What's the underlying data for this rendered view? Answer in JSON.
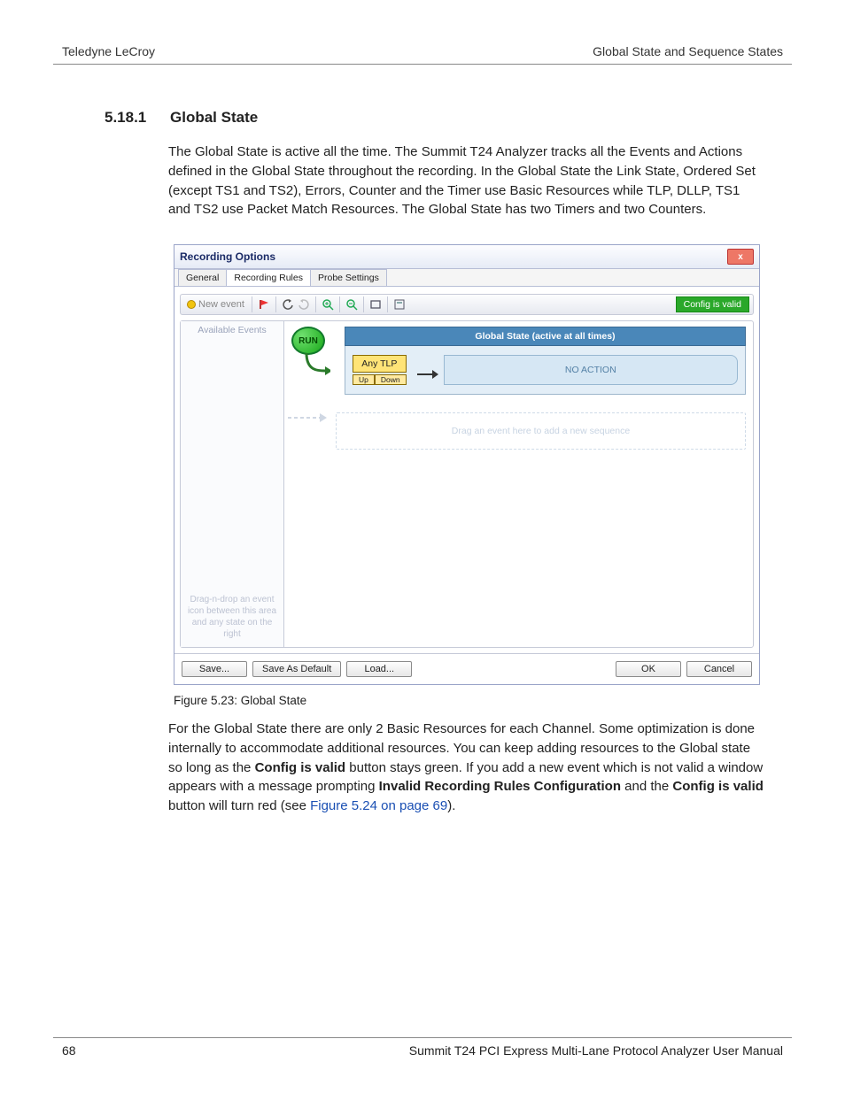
{
  "header": {
    "left": "Teledyne LeCroy",
    "right": "Global State and Sequence States"
  },
  "section": {
    "number": "5.18.1",
    "title": "Global State"
  },
  "paragraphs": {
    "p1": "The Global State is active all the time. The Summit T24 Analyzer tracks all the Events and Actions defined in the Global State throughout the recording. In the Global State the Link State, Ordered Set (except TS1 and TS2), Errors, Counter and the Timer use Basic Resources while TLP, DLLP, TS1 and TS2 use Packet Match Resources.  The Global State has two Timers and two Counters.",
    "p2_pre": "For the Global State there are only 2 Basic Resources for each Channel. Some optimization is done internally to accommodate additional resources. You can keep adding resources to the Global state so long as the ",
    "p2_bold1": "Config is valid",
    "p2_mid1": " button stays green. If you add a new event which is not valid a window appears with a message prompting ",
    "p2_bold2": "Invalid Recording Rules Configuration",
    "p2_mid2": " and the ",
    "p2_bold3": "Config is valid",
    "p2_mid3": " button will turn red (see ",
    "p2_xref": "Figure 5.24 on page 69",
    "p2_end": ")."
  },
  "figure_caption": "Figure 5.23:  Global State",
  "window": {
    "title": "Recording Options",
    "close_glyph": "x",
    "tabs": {
      "general": "General",
      "rules": "Recording Rules",
      "probe": "Probe Settings"
    },
    "toolbar": {
      "new_event": "New event",
      "config_valid": "Config is valid"
    },
    "side": {
      "available": "Available Events",
      "hint": "Drag-n-drop an event icon between this area and any state on the right"
    },
    "run_label": "RUN",
    "state_title": "Global State (active at all times)",
    "any_tlp": "Any TLP",
    "up": "Up",
    "down": "Down",
    "no_action": "NO ACTION",
    "dropzone": "Drag an event here to add a new sequence",
    "buttons": {
      "save": "Save...",
      "save_default": "Save As Default",
      "load": "Load...",
      "ok": "OK",
      "cancel": "Cancel"
    }
  },
  "footer": {
    "page": "68",
    "manual": "Summit T24 PCI Express Multi-Lane Protocol Analyzer User Manual"
  }
}
